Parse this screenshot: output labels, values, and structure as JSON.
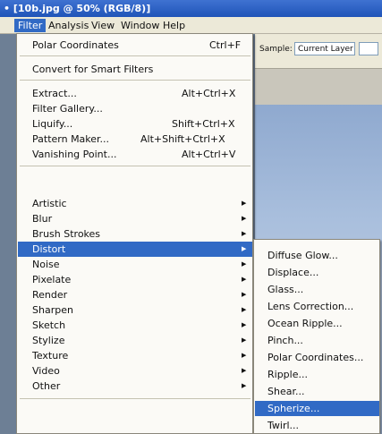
{
  "window": {
    "title": "• [10b.jpg @ 50% (RGB/8)]"
  },
  "menubar": {
    "items": [
      "Filter",
      "Analysis",
      "View",
      "Window",
      "Help"
    ]
  },
  "options_bar": {
    "sample_label": "Sample:",
    "sample_value": "Current Layer"
  },
  "filter_menu": {
    "top_items": [
      {
        "label": "Polar Coordinates",
        "shortcut": "Ctrl+F"
      },
      {
        "label": "Convert for Smart Filters"
      },
      {
        "label": "Extract...",
        "shortcut": "Alt+Ctrl+X"
      },
      {
        "label": "Filter Gallery..."
      },
      {
        "label": "Liquify...",
        "shortcut": "Shift+Ctrl+X"
      },
      {
        "label": "Pattern Maker...",
        "shortcut": "Alt+Shift+Ctrl+X"
      },
      {
        "label": "Vanishing Point...",
        "shortcut": "Alt+Ctrl+V"
      }
    ],
    "submenus": [
      "Artistic",
      "Blur",
      "Brush Strokes",
      "Distort",
      "Noise",
      "Pixelate",
      "Render",
      "Sharpen",
      "Sketch",
      "Stylize",
      "Texture",
      "Video",
      "Other"
    ],
    "highlighted": "Distort"
  },
  "distort_menu": {
    "items": [
      "Diffuse Glow...",
      "Displace...",
      "Glass...",
      "Lens Correction...",
      "Ocean Ripple...",
      "Pinch...",
      "Polar Coordinates...",
      "Ripple...",
      "Shear...",
      "Spherize...",
      "Twirl..."
    ],
    "highlighted": "Spherize..."
  }
}
